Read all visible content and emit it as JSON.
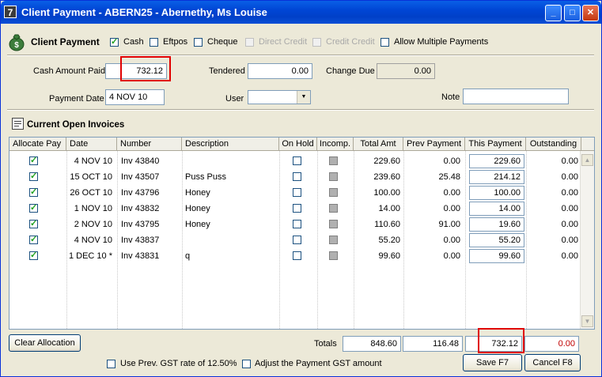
{
  "window": {
    "title": "Client Payment - ABERN25 - Abernethy, Ms Louise",
    "app_icon_glyph": "7",
    "controls": {
      "minimize": "_",
      "maximize": "□",
      "close": "✕"
    }
  },
  "header": {
    "section_title": "Client Payment",
    "icon": "money-bag-icon",
    "methods": [
      {
        "label": "Cash",
        "checked": true,
        "enabled": true
      },
      {
        "label": "Eftpos",
        "checked": false,
        "enabled": true
      },
      {
        "label": "Cheque",
        "checked": false,
        "enabled": true
      },
      {
        "label": "Direct Credit",
        "checked": false,
        "enabled": false
      },
      {
        "label": "Credit Credit",
        "checked": false,
        "enabled": false
      },
      {
        "label": "Allow Multiple Payments",
        "checked": false,
        "enabled": true
      }
    ]
  },
  "form": {
    "cash_amount_label": "Cash Amount Paid",
    "cash_amount_value": "732.12",
    "tendered_label": "Tendered",
    "tendered_value": "0.00",
    "change_due_label": "Change Due",
    "change_due_value": "0.00",
    "payment_date_label": "Payment Date",
    "payment_date_value": "4 NOV 10",
    "user_label": "User",
    "user_value": "",
    "note_label": "Note",
    "note_value": ""
  },
  "invoices": {
    "section_title": "Current Open Invoices",
    "icon": "invoice-icon",
    "columns": [
      "Allocate Pay",
      "Date",
      "Number",
      "Description",
      "On Hold",
      "Incomp.",
      "Total Amt",
      "Prev Payment",
      "This Payment",
      "Outstanding"
    ],
    "rows": [
      {
        "allocate": true,
        "date": "4 NOV 10",
        "number": "Inv 43840",
        "description": "",
        "on_hold": false,
        "incomp": false,
        "total": "229.60",
        "prev": "0.00",
        "this": "229.60",
        "outstanding": "0.00"
      },
      {
        "allocate": true,
        "date": "15 OCT 10",
        "number": "Inv 43507",
        "description": "Puss Puss",
        "on_hold": false,
        "incomp": false,
        "total": "239.60",
        "prev": "25.48",
        "this": "214.12",
        "outstanding": "0.00"
      },
      {
        "allocate": true,
        "date": "26 OCT 10",
        "number": "Inv 43796",
        "description": "Honey",
        "on_hold": false,
        "incomp": false,
        "total": "100.00",
        "prev": "0.00",
        "this": "100.00",
        "outstanding": "0.00"
      },
      {
        "allocate": true,
        "date": "1 NOV 10",
        "number": "Inv 43832",
        "description": "Honey",
        "on_hold": false,
        "incomp": false,
        "total": "14.00",
        "prev": "0.00",
        "this": "14.00",
        "outstanding": "0.00"
      },
      {
        "allocate": true,
        "date": "2 NOV 10",
        "number": "Inv 43795",
        "description": "Honey",
        "on_hold": false,
        "incomp": false,
        "total": "110.60",
        "prev": "91.00",
        "this": "19.60",
        "outstanding": "0.00"
      },
      {
        "allocate": true,
        "date": "4 NOV 10",
        "number": "Inv 43837",
        "description": "",
        "on_hold": false,
        "incomp": false,
        "total": "55.20",
        "prev": "0.00",
        "this": "55.20",
        "outstanding": "0.00"
      },
      {
        "allocate": true,
        "date": "1 DEC 10 *",
        "number": "Inv 43831",
        "description": "q",
        "on_hold": false,
        "incomp": false,
        "total": "99.60",
        "prev": "0.00",
        "this": "99.60",
        "outstanding": "0.00"
      }
    ]
  },
  "footer": {
    "clear_allocation_label": "Clear Allocation",
    "totals_label": "Totals",
    "total_amt": "848.60",
    "total_prev": "116.48",
    "total_this": "732.12",
    "total_outstanding": "0.00",
    "prev_gst_label": "Use Prev. GST rate of 12.50%",
    "adjust_gst_label": "Adjust the Payment GST amount",
    "save_label": "Save F7",
    "cancel_label": "Cancel F8"
  },
  "colors": {
    "titlebar": "#0046d5",
    "window_bg": "#ece9d8",
    "highlight": "#e00000",
    "outstanding_total": "#c00000"
  }
}
